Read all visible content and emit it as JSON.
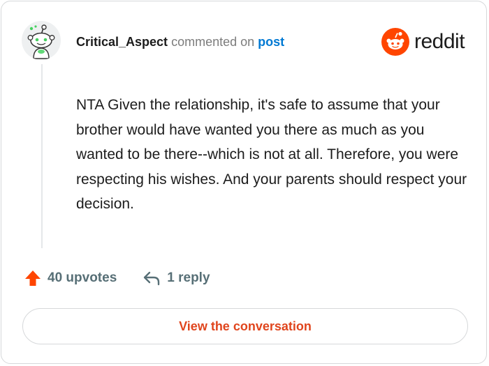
{
  "comment": {
    "username": "Critical_Aspect",
    "action_text": "commented on",
    "post_link": "post",
    "body": "NTA Given the relationship, it's safe to assume that your brother would have wanted you there as much as you wanted to be there--which is not at all. Therefore, you were respecting his wishes. And your parents should respect your decision."
  },
  "brand": {
    "logo_text": "reddit",
    "logo_icon": "reddit-snoo-icon",
    "accent_color": "#ff4500"
  },
  "footer": {
    "upvotes_label": "40 upvotes",
    "upvote_icon": "upvote-arrow-icon",
    "upvote_color": "#ff4500",
    "replies_label": "1 reply",
    "reply_icon": "reply-arrow-icon"
  },
  "cta": {
    "label": "View the conversation",
    "color": "#e0451d"
  }
}
